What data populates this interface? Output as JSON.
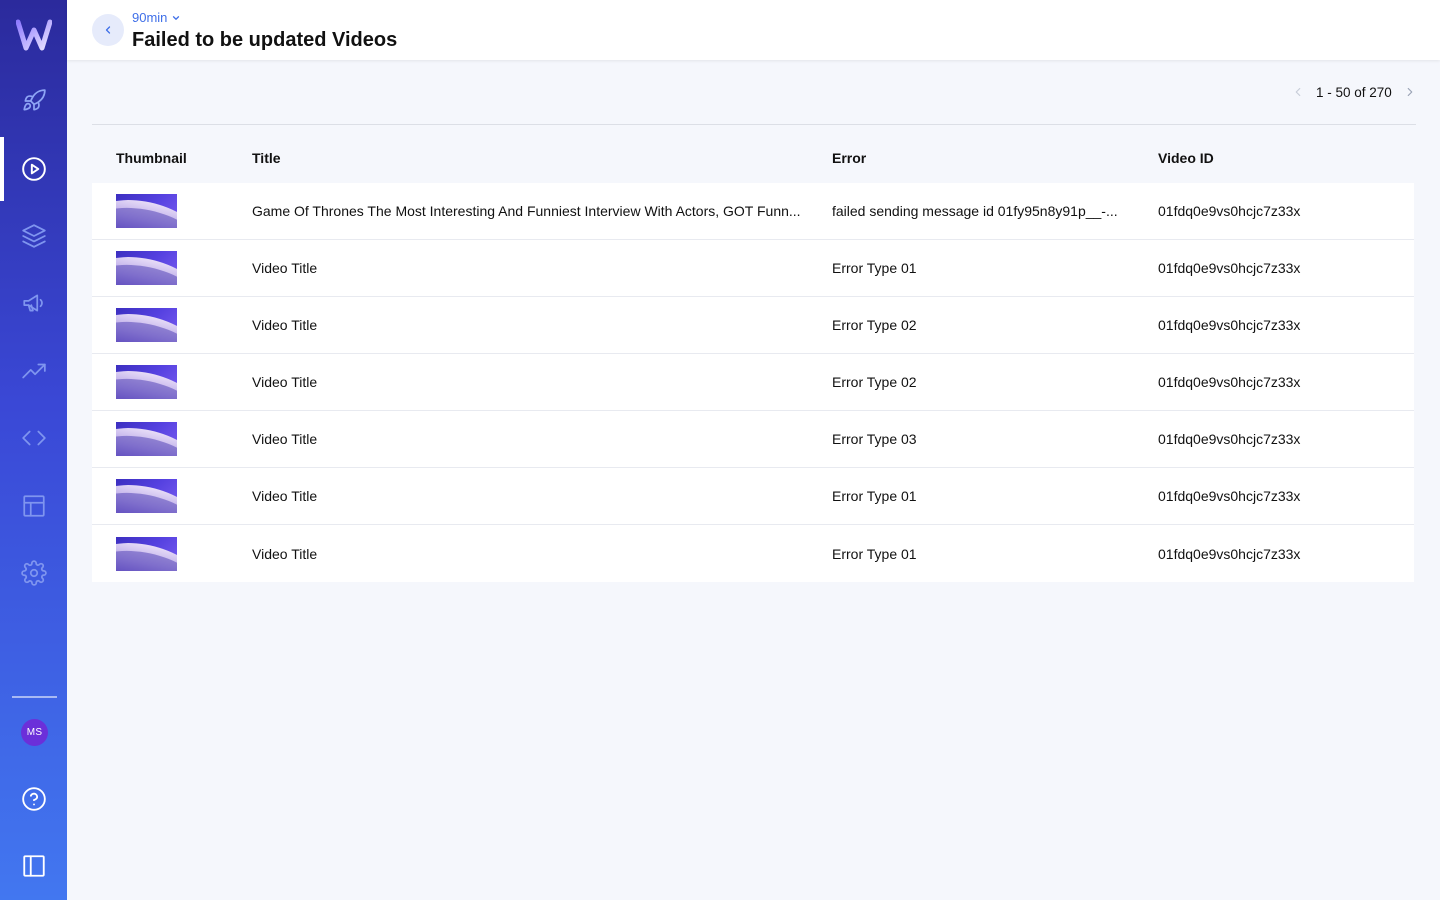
{
  "header": {
    "breadcrumb": "90min",
    "title": "Failed to be updated Videos"
  },
  "sidebar": {
    "avatar_initials": "MS",
    "items": [
      {
        "icon": "rocket-icon"
      },
      {
        "icon": "play-circle-icon",
        "active": true
      },
      {
        "icon": "layers-icon"
      },
      {
        "icon": "megaphone-icon"
      },
      {
        "icon": "trending-up-icon"
      },
      {
        "icon": "code-icon"
      },
      {
        "icon": "layout-icon"
      },
      {
        "icon": "gear-icon"
      },
      {
        "icon": "help-icon"
      },
      {
        "icon": "sidebar-toggle-icon"
      }
    ]
  },
  "pagination": {
    "label": "1 - 50 of 270"
  },
  "table": {
    "columns": [
      "Thumbnail",
      "Title",
      "Error",
      "Video ID"
    ],
    "rows": [
      {
        "title": "Game Of Thrones The Most Interesting And Funniest Interview With Actors, GOT Funn...",
        "error": "failed sending message id 01fy95n8y91p__-...",
        "video_id": "01fdq0e9vs0hcjc7z33x"
      },
      {
        "title": "Video Title",
        "error": "Error Type 01",
        "video_id": "01fdq0e9vs0hcjc7z33x"
      },
      {
        "title": "Video Title",
        "error": "Error Type 02",
        "video_id": "01fdq0e9vs0hcjc7z33x"
      },
      {
        "title": "Video Title",
        "error": "Error Type 02",
        "video_id": "01fdq0e9vs0hcjc7z33x"
      },
      {
        "title": "Video Title",
        "error": "Error Type 03",
        "video_id": "01fdq0e9vs0hcjc7z33x"
      },
      {
        "title": "Video Title",
        "error": "Error Type 01",
        "video_id": "01fdq0e9vs0hcjc7z33x"
      },
      {
        "title": "Video Title",
        "error": "Error Type 01",
        "video_id": "01fdq0e9vs0hcjc7z33x"
      }
    ]
  },
  "colors": {
    "accent": "#3f6fe8",
    "sidebar_top": "#2b2a9c",
    "sidebar_bottom": "#4277f0",
    "avatar": "#6b2fd9"
  }
}
